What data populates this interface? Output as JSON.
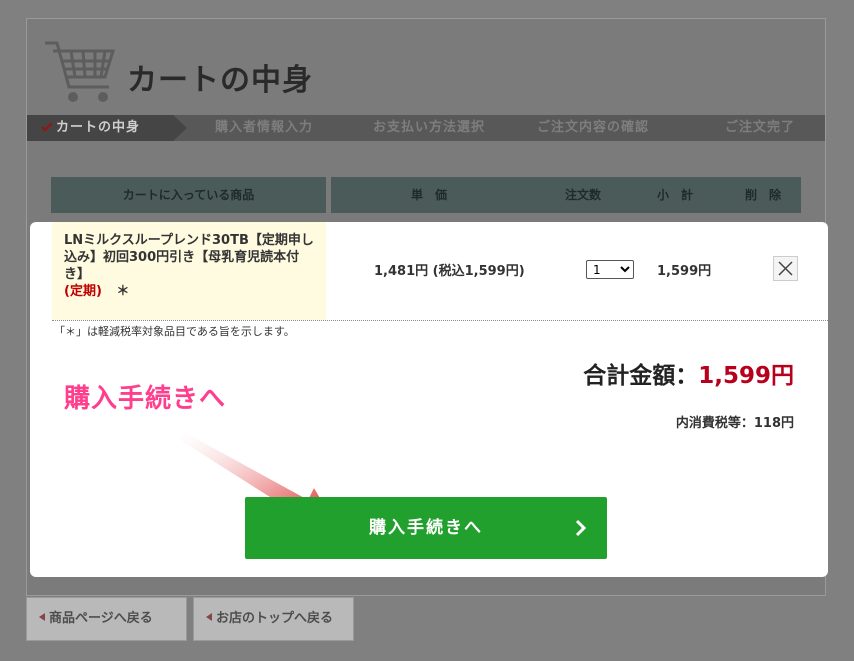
{
  "header": {
    "title": "カートの中身"
  },
  "steps": [
    "カートの中身",
    "購入者情報入力",
    "お支払い方法選択",
    "ご注文内容の確認",
    "ご注文完了"
  ],
  "table": {
    "headers": [
      "カートに入っている商品",
      "単　価",
      "注文数",
      "小　計",
      "削　除"
    ],
    "rows": [
      {
        "product": "LNミルクスループレンド30TB【定期申し込み】初回300円引き【母乳育児読本付き】",
        "tag": "(定期)",
        "mark": "＊",
        "price": "1,481円 (税込1,599円)",
        "qty": "1",
        "subtotal": "1,599円"
      }
    ]
  },
  "note": "「＊」は軽減税率対象品目である旨を示します。",
  "summary": {
    "total_label": "合計金額：",
    "total_amount": "1,599円",
    "tax_label": "内消費税等：",
    "tax_amount": "118円"
  },
  "callout": "購入手続きへ",
  "checkout_button": "購入手続きへ",
  "nav": {
    "back_product": "商品ページへ戻る",
    "back_top": "お店のトップへ戻る"
  },
  "colors": {
    "accent_green": "#22a02e",
    "price_red": "#b8001c",
    "callout_pink": "#ff3f8e"
  }
}
